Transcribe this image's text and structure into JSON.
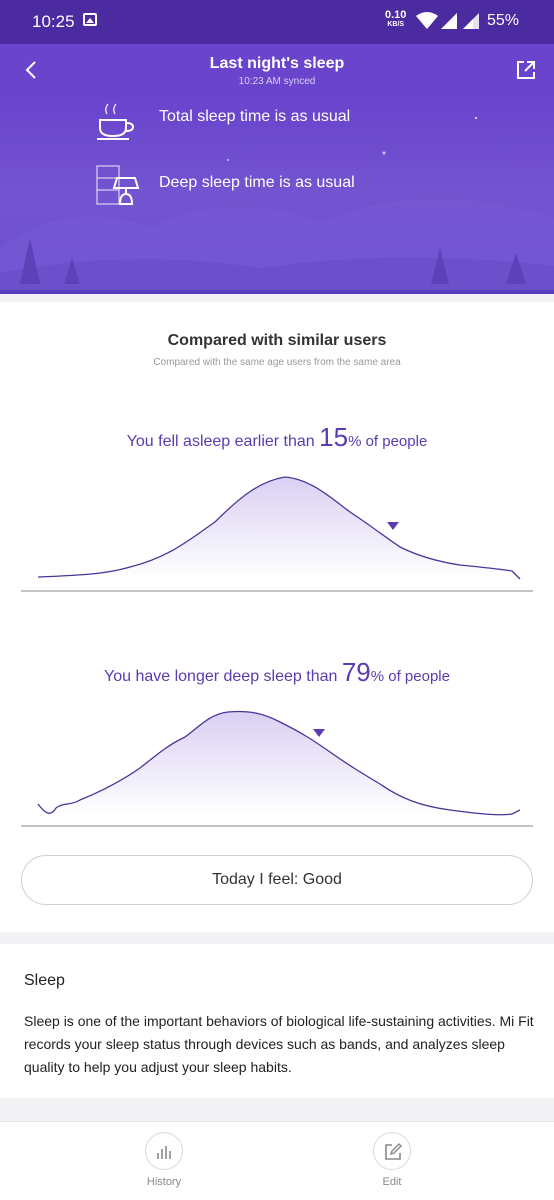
{
  "status_bar": {
    "time": "10:25",
    "net_speed_value": "0.10",
    "net_speed_unit": "KB/S",
    "battery": "55%"
  },
  "header": {
    "title": "Last night's sleep",
    "subtitle": "10:23 AM synced"
  },
  "hero": {
    "items": [
      {
        "label": "Total sleep time is as usual",
        "icon": "coffee-cup-icon"
      },
      {
        "label": "Deep sleep time is as usual",
        "icon": "bedside-lamp-icon"
      }
    ]
  },
  "comparison": {
    "title": "Compared with similar users",
    "subtitle": "Compared with the same age users from the same area",
    "stat1": {
      "prefix": "You fell asleep earlier than ",
      "value": "15",
      "suffix": "% of people"
    },
    "stat2": {
      "prefix": "You have longer deep sleep than ",
      "value": "79",
      "suffix": "% of people"
    }
  },
  "feel_button": {
    "label": "Today I feel: Good"
  },
  "info": {
    "title": "Sleep",
    "body": "Sleep is one of the important behaviors of biological life-sustaining activities. Mi Fit records your sleep status through devices such as bands, and analyzes sleep quality to help you adjust your sleep habits."
  },
  "tabbar": {
    "items": [
      {
        "label": "History",
        "icon": "bar-chart-icon"
      },
      {
        "label": "Edit",
        "icon": "edit-icon"
      }
    ]
  },
  "colors": {
    "primary": "#6a44cd",
    "status_bar": "#4c2aa0",
    "accent_text": "#5a3cb0",
    "curve": "#4b3399"
  }
}
